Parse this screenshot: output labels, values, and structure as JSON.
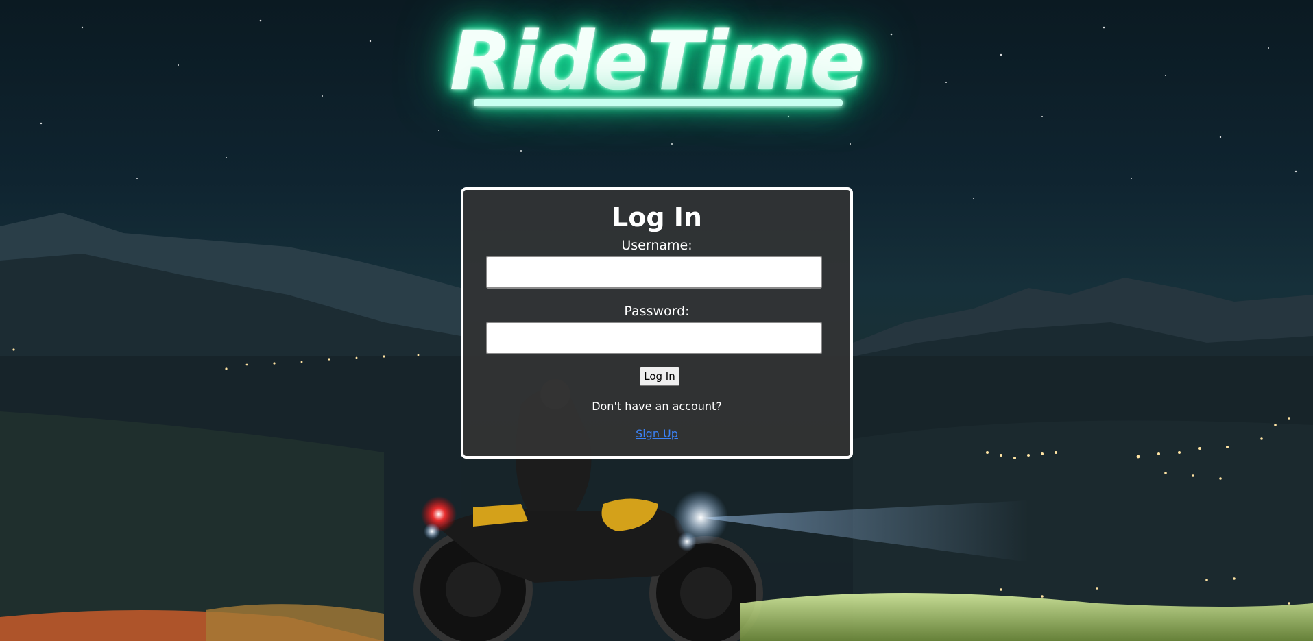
{
  "brand": {
    "logo_text": "RideTime",
    "glow_color": "#18e39a"
  },
  "login": {
    "title": "Log In",
    "username_label": "Username:",
    "username_value": "",
    "password_label": "Password:",
    "password_value": "",
    "submit_label": "Log In",
    "no_account_text": "Don't have an account?",
    "signup_link": "Sign Up"
  },
  "colors": {
    "panel_background": "#343434",
    "panel_border": "#ffffff",
    "link": "#3b82f6"
  }
}
